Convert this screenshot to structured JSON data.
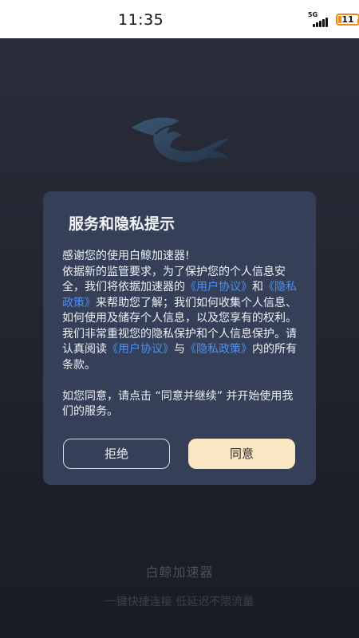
{
  "status_bar": {
    "time": "11:35",
    "network_label": "5G",
    "battery_level": "11",
    "battery_color": "#f0901a"
  },
  "background": {
    "logo_icon": "whale-logo-icon",
    "brand_name": "白鲸加速器",
    "slogan": "一键快捷连接 低延迟不限流量"
  },
  "dialog": {
    "title": "服务和隐私提示",
    "greeting": "感谢您的使用白鲸加速器!",
    "para_1": "依据新的监管要求，为了保护您的个人信息安全，我们将依据加速器的",
    "link_user_agreement": "《用户协议》",
    "and_1": "和",
    "link_privacy_policy": "《隐私政策》",
    "para_2": "来帮助您了解；我们如何收集个人信息、如何使用及储存个人信息，以及您享有的权利。 我们非常重视您的隐私保护和个人信息保护。请认真阅读",
    "link_user_agreement_2": "《用户协议》",
    "and_2": "与",
    "link_privacy_policy_2": "《隐私政策》",
    "para_3": "内的所有条款。",
    "para_4": "如您同意，请点击 “同意并继续” 并开始使用我们的服务。",
    "refuse_label": "拒绝",
    "agree_label": "同意",
    "link_color": "#4d8ff0",
    "agree_bg": "#fbe6c3"
  }
}
